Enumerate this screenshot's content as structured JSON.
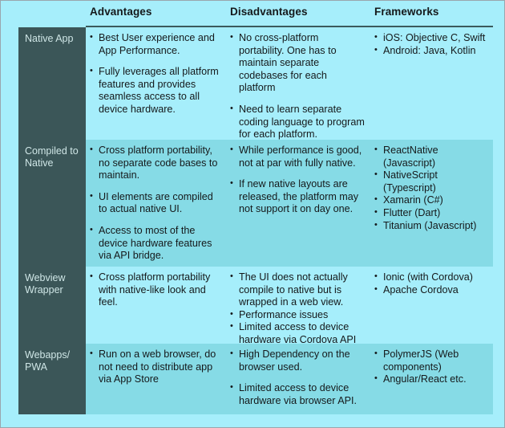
{
  "table": {
    "columns": [
      {
        "key": "category",
        "label": ""
      },
      {
        "key": "advantages",
        "label": "Advantages"
      },
      {
        "key": "disadvantages",
        "label": "Disadvantages"
      },
      {
        "key": "frameworks",
        "label": "Frameworks"
      }
    ],
    "colors": {
      "page_background": "#a6eefb",
      "row_tint_alt": "#86dbe6",
      "label_column_background": "#3b5658",
      "label_column_text": "#cfe6e6",
      "body_text": "#15191b",
      "header_rule": "#3b5a5c",
      "outer_border": "#9aa6ad"
    },
    "rows": [
      {
        "category": "Native App",
        "advantages": [
          "Best User experience and App Performance.",
          "Fully leverages all platform features and provides seamless access to all device hardware."
        ],
        "disadvantages": [
          "No cross-platform portability. One has to maintain separate codebases for each platform",
          "Need to learn separate coding language to program for each platform."
        ],
        "frameworks": [
          "iOS: Objective C, Swift",
          "Android: Java, Kotlin"
        ],
        "frameworks_tight": true
      },
      {
        "category": "Compiled to Native",
        "advantages": [
          "Cross platform portability, no separate code bases to maintain.",
          "UI elements are compiled to actual native UI.",
          "Access to most of the device hardware features via API bridge."
        ],
        "disadvantages": [
          "While performance is good, not at par with fully native.",
          "If new native layouts are released, the platform may not support it on day one."
        ],
        "frameworks": [
          "ReactNative (Javascript)",
          "NativeScript (Typescript)",
          "Xamarin (C#)",
          "Flutter (Dart)",
          "Titanium (Javascript)"
        ],
        "frameworks_tight": true
      },
      {
        "category": "Webview Wrapper",
        "advantages": [
          "Cross platform portability with native-like look and feel."
        ],
        "disadvantages": [
          "The UI does not actually compile to native but is wrapped in a web view.",
          "Performance issues",
          "Limited access to device hardware via Cordova API"
        ],
        "disadvantages_tight": true,
        "frameworks": [
          "Ionic (with Cordova)",
          "Apache Cordova"
        ],
        "frameworks_tight": true
      },
      {
        "category": "Webapps/ PWA",
        "advantages": [
          "Run on a web browser, do not need to distribute app via App Store"
        ],
        "disadvantages": [
          "High Dependency on the browser used.",
          "Limited access to device hardware via browser API."
        ],
        "frameworks": [
          "PolymerJS (Web components)",
          "Angular/React etc."
        ],
        "frameworks_tight": true
      }
    ]
  }
}
